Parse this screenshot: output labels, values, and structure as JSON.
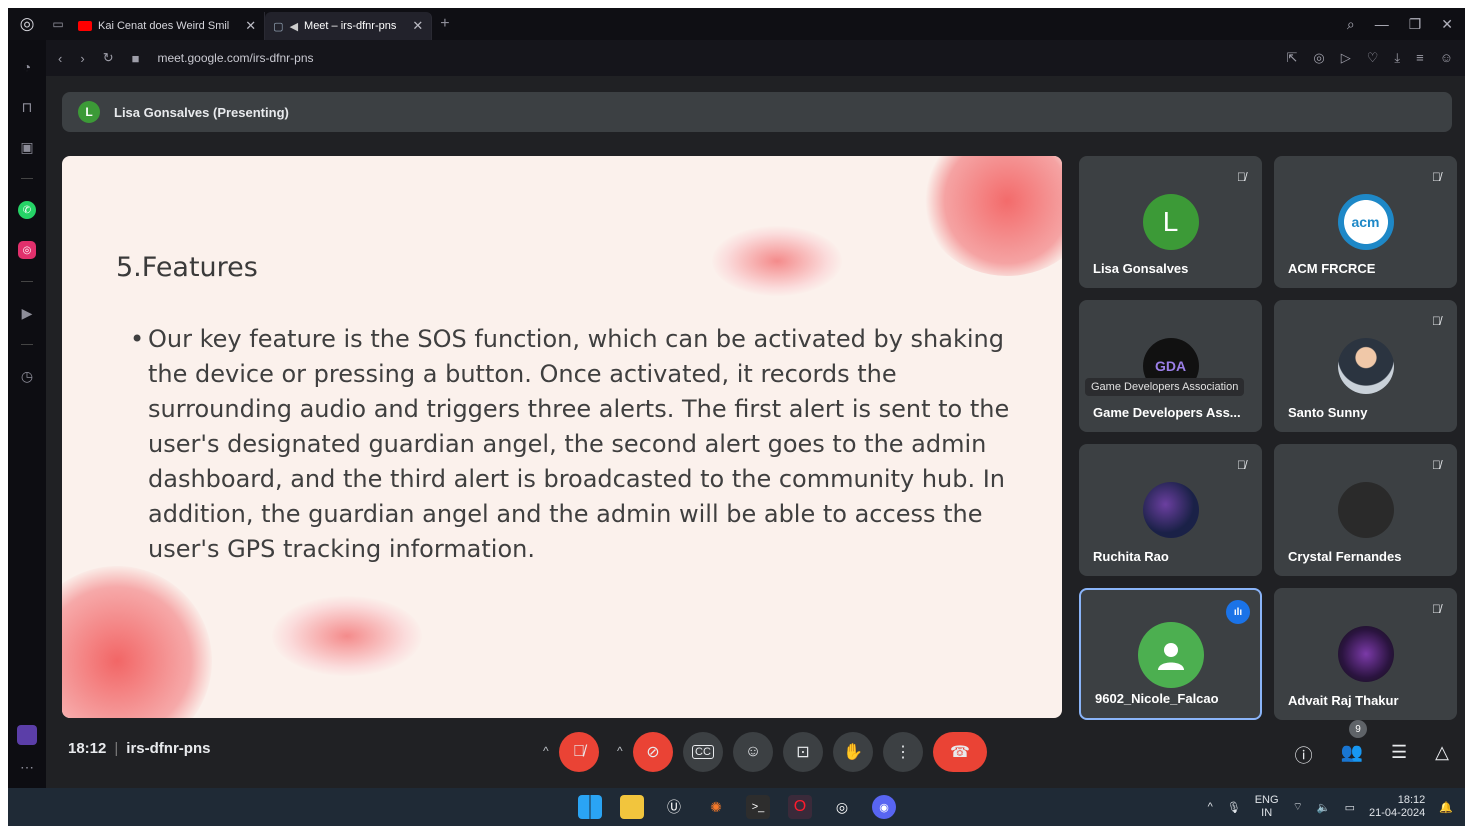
{
  "browser": {
    "tabs": [
      {
        "title": "Kai Cenat does Weird Smil",
        "active": false
      },
      {
        "title": "Meet – irs-dfnr-pns",
        "active": true
      }
    ],
    "url": "meet.google.com/irs-dfnr-pns"
  },
  "meet": {
    "presenting_initial": "L",
    "presenting_label": "Lisa Gonsalves (Presenting)",
    "slide": {
      "title": "5.Features",
      "bullet": "Our key feature is the SOS function, which can be activated by shaking the device or pressing a button. Once activated, it records the surrounding audio and triggers three alerts. The first alert is sent to the user's designated guardian angel, the second alert goes to the admin dashboard, and the third alert is broadcasted to the community hub. In addition, the guardian angel and the admin will be able to access the user's GPS tracking information."
    },
    "participants": [
      {
        "name": "Lisa Gonsalves",
        "initial": "L",
        "color": "#3c9a37",
        "muted": true
      },
      {
        "name": "ACM FRCRCE",
        "initial": "acm",
        "color": "#1e88c7",
        "muted": true
      },
      {
        "name": "Game Developers Ass...",
        "tooltip": "Game Developers Association",
        "initial": "GDA",
        "color": "#111111",
        "muted": false
      },
      {
        "name": "Santo Sunny",
        "initial": "",
        "color": "#c9d1d9",
        "muted": true
      },
      {
        "name": "Ruchita Rao",
        "initial": "",
        "color": "#1a2147",
        "muted": true
      },
      {
        "name": "Crystal Fernandes",
        "initial": "",
        "color": "#2a2a2a",
        "muted": true
      },
      {
        "name": "9602_Nicole_Falcao",
        "initial": "",
        "color": "#5f6368",
        "muted": false,
        "speaking": true
      },
      {
        "name": "Advait Raj Thakur",
        "initial": "",
        "color": "#2b1440",
        "muted": true
      }
    ],
    "time": "18:12",
    "meeting_code": "irs-dfnr-pns",
    "people_count": "9"
  },
  "taskbar": {
    "lang_line1": "ENG",
    "lang_line2": "IN",
    "clock_time": "18:12",
    "clock_date": "21-04-2024"
  }
}
